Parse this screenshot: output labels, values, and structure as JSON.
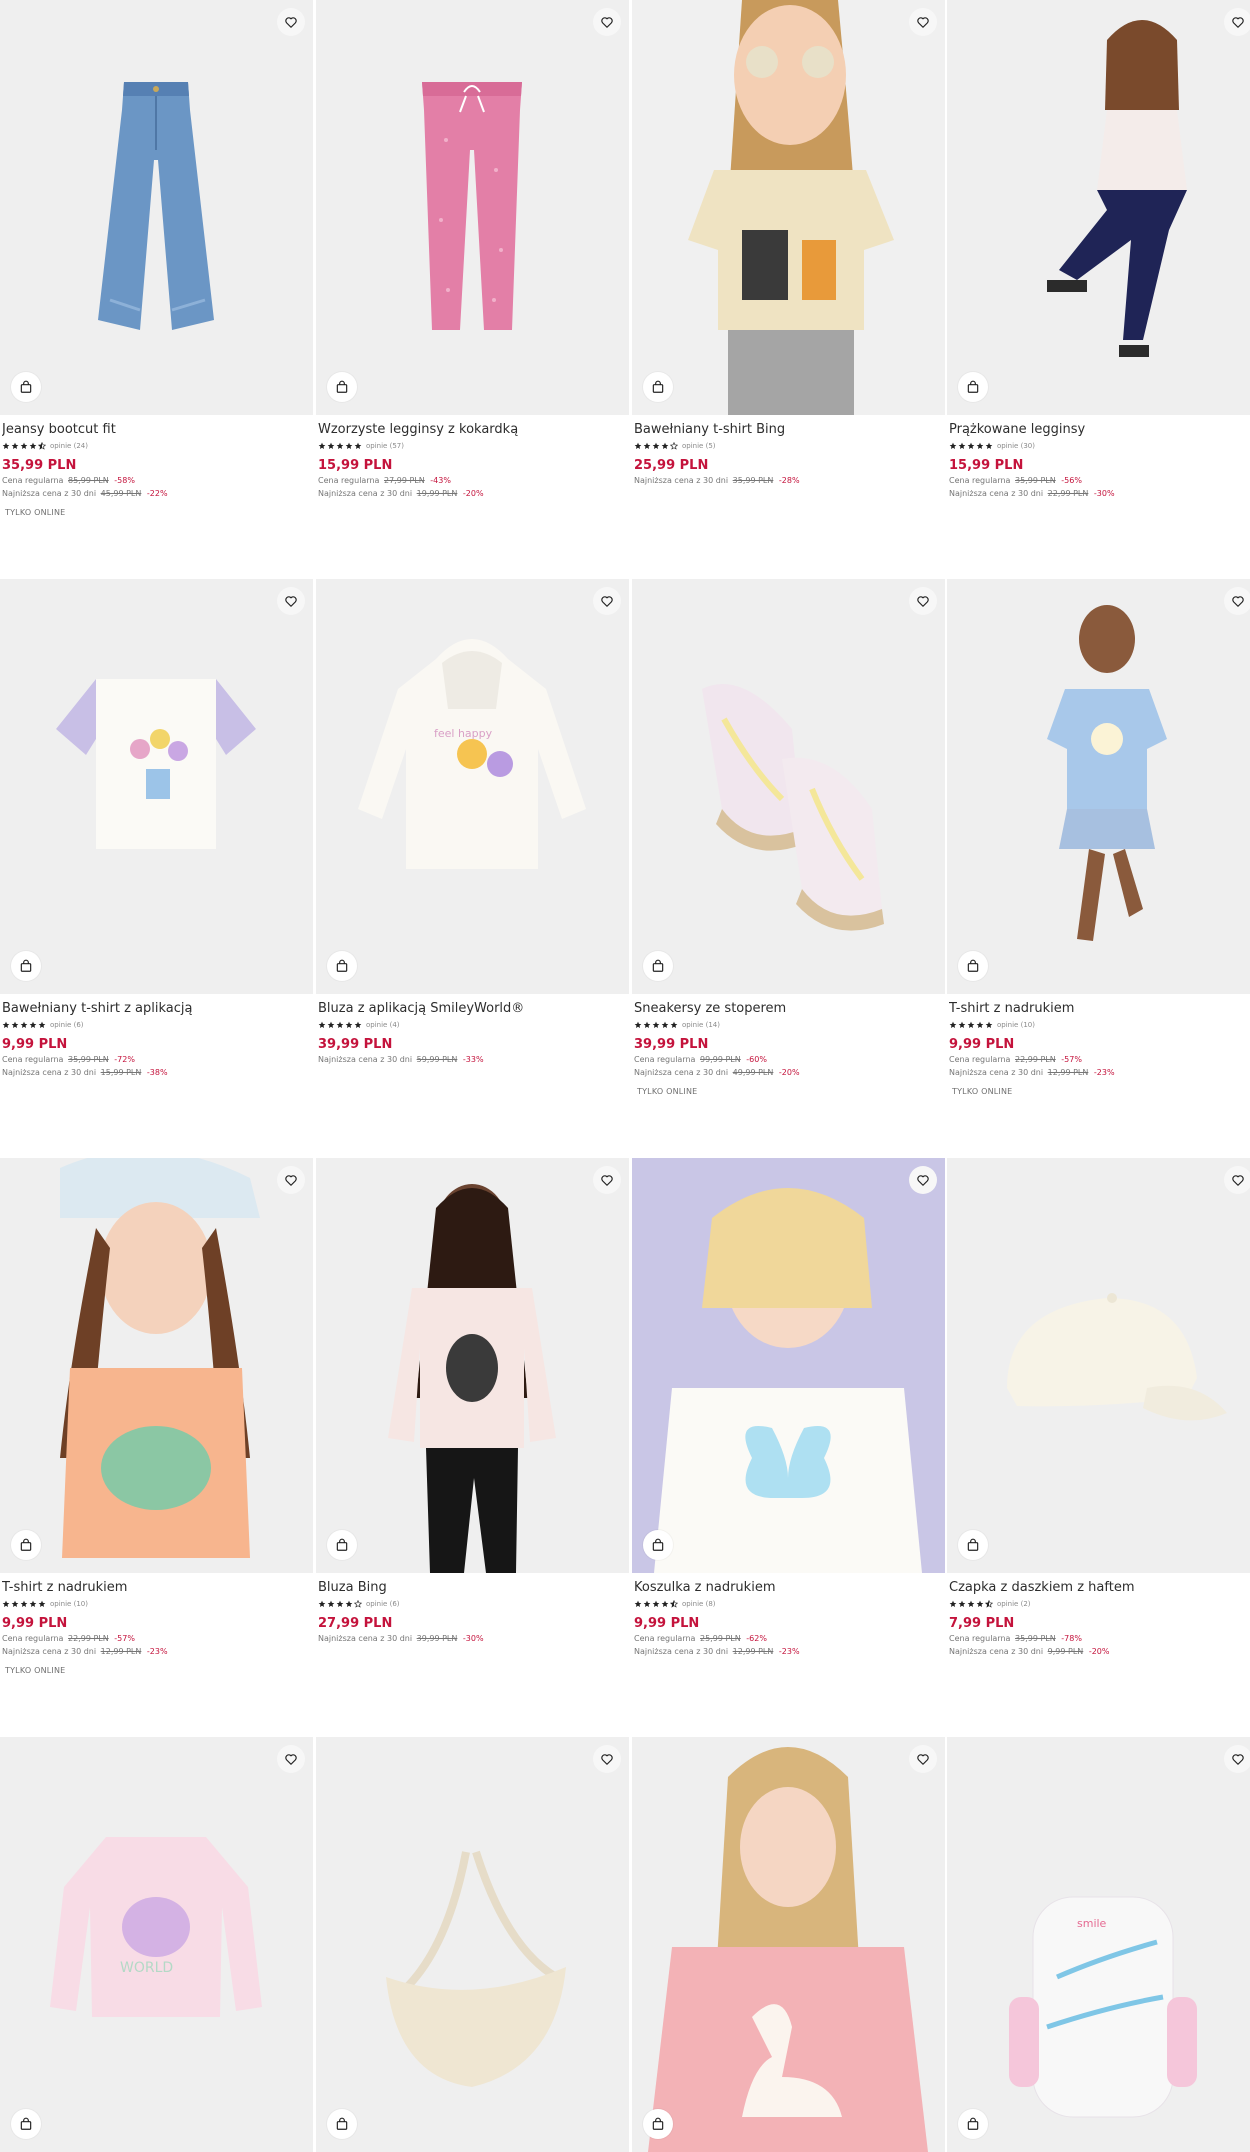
{
  "labels": {
    "regular_price": "Cena regularna",
    "lowest_30": "Najniższa cena z 30 dni"
  },
  "colors": {
    "accent_red": "#c4133c",
    "text": "#2d2d2d",
    "muted": "#767676"
  },
  "products": [
    {
      "name": "Jeansy bootcut fit",
      "rating": 4.5,
      "reviews": "opinie (24)",
      "price": "35,99 PLN",
      "regular_old": "85,99 PLN",
      "regular_disc": "-58%",
      "lowest_old": "45,99 PLN",
      "lowest_disc": "-22%",
      "badge": "TYLKO ONLINE",
      "image": "jeans-image"
    },
    {
      "name": "Wzorzyste legginsy z kokardką",
      "rating": 5,
      "reviews": "opinie (57)",
      "price": "15,99 PLN",
      "regular_old": "27,99 PLN",
      "regular_disc": "-43%",
      "lowest_old": "19,99 PLN",
      "lowest_disc": "-20%",
      "badge": "",
      "image": "leggings-image"
    },
    {
      "name": "Bawełniany t-shirt Bing",
      "rating": 4,
      "reviews": "opinie (5)",
      "price": "25,99 PLN",
      "regular_old": "",
      "regular_disc": "",
      "lowest_old": "35,99 PLN",
      "lowest_disc": "-28%",
      "badge": "",
      "image": "girl-tshirt-bing-image"
    },
    {
      "name": "Prążkowane legginsy",
      "rating": 5,
      "reviews": "opinie (30)",
      "price": "15,99 PLN",
      "regular_old": "35,99 PLN",
      "regular_disc": "-56%",
      "lowest_old": "22,99 PLN",
      "lowest_disc": "-30%",
      "badge": "",
      "image": "girl-leggings-image"
    },
    {
      "name": "Bawełniany t-shirt z aplikacją",
      "rating": 5,
      "reviews": "opinie (6)",
      "price": "9,99 PLN",
      "regular_old": "35,99 PLN",
      "regular_disc": "-72%",
      "lowest_old": "15,99 PLN",
      "lowest_disc": "-38%",
      "badge": "",
      "image": "tshirt-flowers-image"
    },
    {
      "name": "Bluza z aplikacją SmileyWorld®",
      "rating": 5,
      "reviews": "opinie (4)",
      "price": "39,99 PLN",
      "regular_old": "",
      "regular_disc": "",
      "lowest_old": "59,99 PLN",
      "lowest_disc": "-33%",
      "badge": "",
      "image": "hoodie-image"
    },
    {
      "name": "Sneakersy ze stoperem",
      "rating": 5,
      "reviews": "opinie (14)",
      "price": "39,99 PLN",
      "regular_old": "99,99 PLN",
      "regular_disc": "-60%",
      "lowest_old": "49,99 PLN",
      "lowest_disc": "-20%",
      "badge": "TYLKO ONLINE",
      "image": "sneakers-image"
    },
    {
      "name": "T-shirt z nadrukiem",
      "rating": 5,
      "reviews": "opinie (10)",
      "price": "9,99 PLN",
      "regular_old": "22,99 PLN",
      "regular_disc": "-57%",
      "lowest_old": "12,99 PLN",
      "lowest_disc": "-23%",
      "badge": "TYLKO ONLINE",
      "image": "girl-blue-tshirt-image"
    },
    {
      "name": "T-shirt z nadrukiem",
      "rating": 5,
      "reviews": "opinie (10)",
      "price": "9,99 PLN",
      "regular_old": "22,99 PLN",
      "regular_disc": "-57%",
      "lowest_old": "12,99 PLN",
      "lowest_disc": "-23%",
      "badge": "TYLKO ONLINE",
      "image": "girl-peach-tshirt-image"
    },
    {
      "name": "Bluza Bing",
      "rating": 4,
      "reviews": "opinie (6)",
      "price": "27,99 PLN",
      "regular_old": "",
      "regular_disc": "",
      "lowest_old": "39,99 PLN",
      "lowest_disc": "-30%",
      "badge": "",
      "image": "girl-bing-sweatshirt-image"
    },
    {
      "name": "Koszulka z nadrukiem",
      "rating": 4.5,
      "reviews": "opinie (8)",
      "price": "9,99 PLN",
      "regular_old": "25,99 PLN",
      "regular_disc": "-62%",
      "lowest_old": "12,99 PLN",
      "lowest_disc": "-23%",
      "badge": "",
      "image": "girl-butterfly-shirt-image"
    },
    {
      "name": "Czapka z daszkiem z haftem",
      "rating": 4.5,
      "reviews": "opinie (2)",
      "price": "7,99 PLN",
      "regular_old": "35,99 PLN",
      "regular_disc": "-78%",
      "lowest_old": "9,99 PLN",
      "lowest_disc": "-20%",
      "badge": "",
      "image": "cap-image"
    },
    {
      "name": "",
      "rating": 0,
      "reviews": "",
      "price": "",
      "regular_old": "",
      "regular_disc": "",
      "lowest_old": "",
      "lowest_disc": "",
      "badge": "",
      "image": "pink-longsleeve-image"
    },
    {
      "name": "",
      "rating": 0,
      "reviews": "",
      "price": "",
      "regular_old": "",
      "regular_disc": "",
      "lowest_old": "",
      "lowest_disc": "",
      "badge": "",
      "image": "crossbody-bag-image"
    },
    {
      "name": "",
      "rating": 0,
      "reviews": "",
      "price": "",
      "regular_old": "",
      "regular_disc": "",
      "lowest_old": "",
      "lowest_disc": "",
      "badge": "",
      "image": "girl-swan-sweater-image"
    },
    {
      "name": "",
      "rating": 0,
      "reviews": "",
      "price": "",
      "regular_old": "",
      "regular_disc": "",
      "lowest_old": "",
      "lowest_disc": "",
      "badge": "",
      "image": "backpack-image"
    }
  ]
}
